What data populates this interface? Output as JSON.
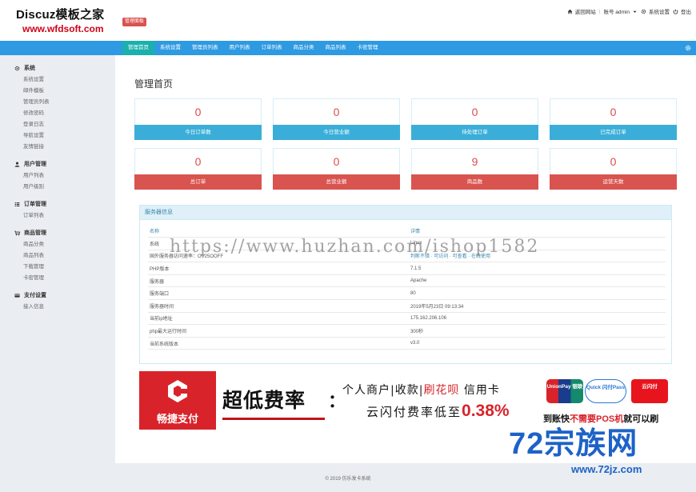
{
  "header": {
    "logo_title": "Discuz模板之家",
    "logo_url": "www.wfdsoft.com",
    "badge": "管理面板",
    "links": {
      "home": "返回网站",
      "account": "账号 admin",
      "settings": "系统设置",
      "logout": "登出"
    }
  },
  "nav": {
    "items": [
      "管理首页",
      "系统设置",
      "管理员列表",
      "用户列表",
      "订单列表",
      "商品分类",
      "商品列表",
      "卡密管理"
    ],
    "active_index": 0
  },
  "sidebar": {
    "groups": [
      {
        "title": "系统",
        "icon": "gear-icon",
        "items": [
          "系统设置",
          "邮件模板",
          "管理员列表",
          "修改密码",
          "登录日志",
          "导航设置",
          "友情链接"
        ]
      },
      {
        "title": "用户管理",
        "icon": "user-icon",
        "items": [
          "用户列表",
          "用户级别"
        ]
      },
      {
        "title": "订单管理",
        "icon": "list-icon",
        "items": [
          "订单列表"
        ]
      },
      {
        "title": "商品管理",
        "icon": "cart-icon",
        "items": [
          "商品分类",
          "商品列表",
          "下载管理",
          "卡密管理"
        ]
      },
      {
        "title": "支付设置",
        "icon": "card-icon",
        "items": [
          "接入信息"
        ]
      }
    ]
  },
  "main": {
    "title": "管理首页",
    "stats": [
      {
        "value": "0",
        "label": "今日订单数",
        "color": "blue"
      },
      {
        "value": "0",
        "label": "今日营业额",
        "color": "blue"
      },
      {
        "value": "0",
        "label": "待处理订单",
        "color": "blue"
      },
      {
        "value": "0",
        "label": "已完成订单",
        "color": "blue"
      },
      {
        "value": "0",
        "label": "总订单",
        "color": "red"
      },
      {
        "value": "0",
        "label": "总营业额",
        "color": "red"
      },
      {
        "value": "9",
        "label": "商品数",
        "color": "red"
      },
      {
        "value": "0",
        "label": "运营天数",
        "color": "red"
      }
    ],
    "server_panel": {
      "title": "服务器信息",
      "columns": [
        "名称",
        "详情"
      ],
      "rows": [
        [
          "系统",
          "Linux"
        ],
        [
          "国外服务器访问速率：OV25OOFF",
          "判断不错 · 可访问 · 可查看 · 在线使用"
        ],
        [
          "PHP版本",
          "7.1.5"
        ],
        [
          "服务器",
          "Apache"
        ],
        [
          "服务端口",
          "80"
        ],
        [
          "服务器时间",
          "2019年5月23日 09:13:34"
        ],
        [
          "当前ip地址",
          "175.162.206.106"
        ],
        [
          "php最大运行时间",
          "300秒"
        ],
        [
          "当前系统版本",
          "v3.0"
        ]
      ]
    },
    "watermark": "https://www.huzhan.com/ishop1582"
  },
  "banner": {
    "brand": "畅捷支付",
    "headline": "超低费率",
    "colon": "：",
    "line1_a": "个人商户|收款|",
    "line1_b": "刷花呗",
    "line1_c": " 信用卡",
    "line2_a": "云闪付费率低至",
    "line2_pct": "0.38%",
    "cards": {
      "unionpay": "UnionPay 银联",
      "quickpass": "Quick 闪付Pass",
      "yunshanfu": "云闪付"
    },
    "sub_a": "到账快",
    "sub_b": "不需要POS机",
    "sub_c": "就可以刷"
  },
  "site_mark": {
    "big": "72宗族网",
    "small": "www.72jz.com"
  },
  "footer": {
    "text": "© 2019 仿乐发卡系统"
  },
  "colors": {
    "nav": "#2e9ae2",
    "nav_active": "#1bb0ad",
    "stat_blue": "#3aaed8",
    "stat_red": "#d9534f",
    "number": "#e04b4b"
  }
}
